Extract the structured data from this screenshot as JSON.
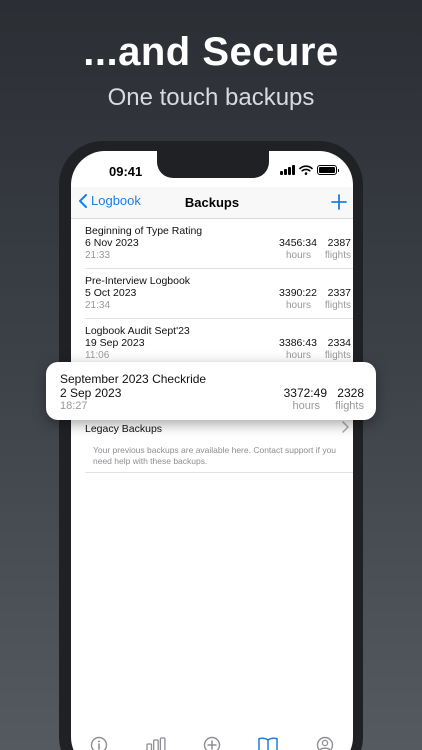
{
  "promo": {
    "headline": "...and Secure",
    "subline": "One touch backups"
  },
  "status_bar": {
    "time": "09:41",
    "icons": [
      "cellular-signal-icon",
      "wifi-icon",
      "battery-icon"
    ]
  },
  "navbar": {
    "back_label": "Logbook",
    "title": "Backups",
    "add_icon": "plus-icon"
  },
  "backups": [
    {
      "name": "Beginning of Type Rating",
      "date": "6 Nov 2023",
      "time": "21:33",
      "hours": "3456:34",
      "flights": "2387",
      "hours_unit": "hours",
      "flights_unit": "flights"
    },
    {
      "name": "Pre-Interview Logbook",
      "date": "5 Oct 2023",
      "time": "21:34",
      "hours": "3390:22",
      "flights": "2337",
      "hours_unit": "hours",
      "flights_unit": "flights"
    },
    {
      "name": "Logbook Audit Sept'23",
      "date": "19 Sep 2023",
      "time": "11:06",
      "hours": "3386:43",
      "flights": "2334",
      "hours_unit": "hours",
      "flights_unit": "flights"
    }
  ],
  "highlighted_backup": {
    "name": "September 2023 Checkride",
    "date": "2 Sep 2023",
    "time": "18:27",
    "hours": "3372:49",
    "flights": "2328",
    "hours_unit": "hours",
    "flights_unit": "flights"
  },
  "legacy": {
    "label": "Legacy Backups",
    "note": "Your previous backups are available here. Contact support if you need help with these backups."
  },
  "tabbar": {
    "icons": [
      "info-icon",
      "bar-chart-icon",
      "add-circle-icon",
      "book-icon",
      "profile-icon"
    ],
    "active_index": 3
  },
  "colors": {
    "accent": "#1e7ee0",
    "inactive_tab": "#8e8e93"
  }
}
